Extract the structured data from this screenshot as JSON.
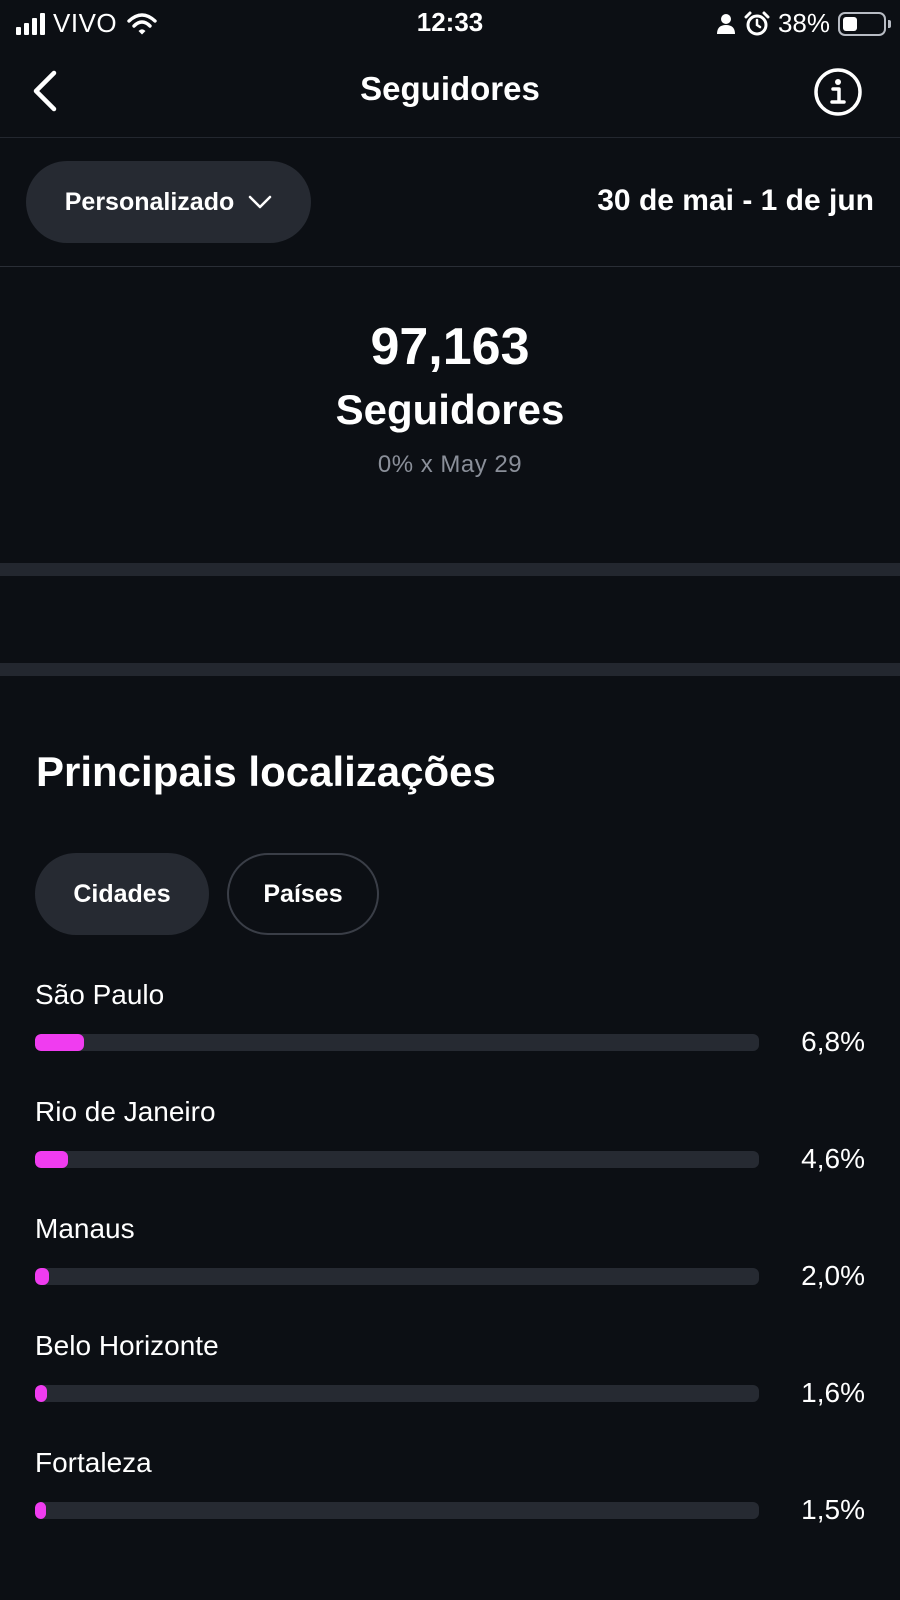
{
  "status_bar": {
    "carrier": "VIVO",
    "time": "12:33",
    "battery_percent": "38%",
    "battery_level": 0.38,
    "icons": [
      "signal-icon",
      "wifi-icon",
      "person-icon",
      "alarm-icon",
      "battery-icon"
    ]
  },
  "header": {
    "title": "Seguidores",
    "back_icon": "chevron-left-icon",
    "info_icon": "info-icon"
  },
  "filter": {
    "range_label": "Personalizado",
    "dropdown_icon": "chevron-down-icon",
    "date_range": "30 de mai - 1 de jun"
  },
  "summary": {
    "count": "97,163",
    "label": "Seguidores",
    "comparison": "0% x May 29"
  },
  "locations": {
    "title": "Principais localizações",
    "tabs": [
      {
        "label": "Cidades",
        "active": true
      },
      {
        "label": "Países",
        "active": false
      }
    ],
    "items": [
      {
        "name": "São Paulo",
        "percent_label": "6,8%",
        "percent": 6.8
      },
      {
        "name": "Rio de Janeiro",
        "percent_label": "4,6%",
        "percent": 4.6
      },
      {
        "name": "Manaus",
        "percent_label": "2,0%",
        "percent": 2.0
      },
      {
        "name": "Belo Horizonte",
        "percent_label": "1,6%",
        "percent": 1.6
      },
      {
        "name": "Fortaleza",
        "percent_label": "1,5%",
        "percent": 1.5
      }
    ]
  },
  "colors": {
    "background": "#0c0f14",
    "surface": "#262a32",
    "accent": "#f03cf0",
    "muted_text": "#8a8f99"
  }
}
